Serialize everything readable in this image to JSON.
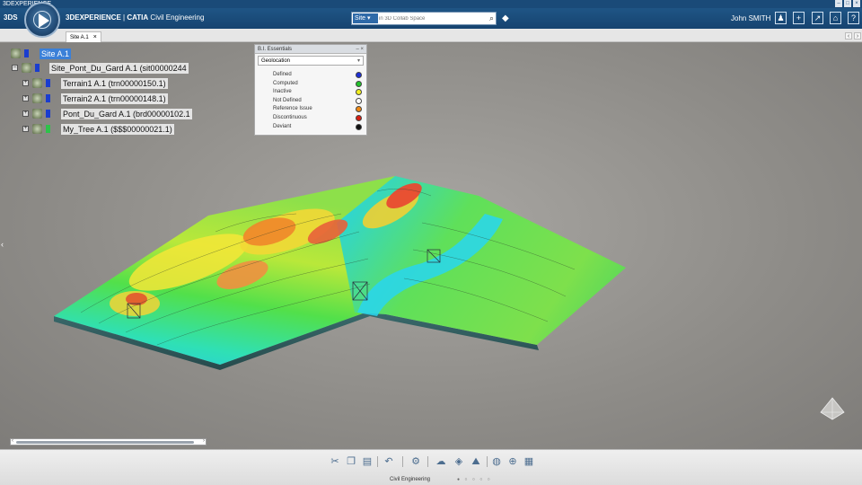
{
  "window": {
    "title": "3DEXPERIENCE",
    "controls": [
      "–",
      "□",
      "×"
    ]
  },
  "topbar": {
    "brand_mark": "3DS",
    "app_brand": "3DEXPERIENCE",
    "app_separator": " | ",
    "app_product": "CATIA",
    "app_role": " Civil Engineering",
    "search_scope": "Site ▾",
    "search_placeholder": "in 3D Collab Space",
    "user": "John SMITH",
    "buttons": [
      "user-icon",
      "plus-icon",
      "share-icon",
      "home-icon",
      "help-icon"
    ]
  },
  "tabs": [
    {
      "label": "Site A.1",
      "close": "×"
    }
  ],
  "tree": {
    "nodes": [
      {
        "label": "Site A.1",
        "flag_color": "#1a3dcf",
        "selected": true,
        "expander": ""
      },
      {
        "label": "Site_Pont_Du_Gard A.1 (sit00000244",
        "flag_color": "#1a3dcf",
        "selected": false,
        "expander": "–"
      },
      {
        "label": "Terrain1 A.1 (trn00000150.1)",
        "flag_color": "#1a3dcf",
        "selected": false,
        "expander": "+"
      },
      {
        "label": "Terrain2 A.1 (trn00000148.1)",
        "flag_color": "#1a3dcf",
        "selected": false,
        "expander": "+"
      },
      {
        "label": "Pont_Du_Gard A.1 (brd00000102.1",
        "flag_color": "#1a3dcf",
        "selected": false,
        "expander": "+"
      },
      {
        "label": "My_Tree A.1 ($$$00000021.1)",
        "flag_color": "#2ec24a",
        "selected": false,
        "expander": "+"
      }
    ]
  },
  "bi_panel": {
    "title": "B.I. Essentials",
    "selected": "Geolocation",
    "legend": [
      {
        "label": "Defined",
        "color": "#1e2fd6"
      },
      {
        "label": "Computed",
        "color": "#22c22a"
      },
      {
        "label": "Inactive",
        "color": "#f2ee1e"
      },
      {
        "label": "Not Defined",
        "color": "#ffffff"
      },
      {
        "label": "Reference Issue",
        "color": "#f08a16"
      },
      {
        "label": "Discontinuous",
        "color": "#d81e12"
      },
      {
        "label": "Deviant",
        "color": "#111111"
      }
    ]
  },
  "viewport": {
    "nav_arrow": "‹"
  },
  "toolbar": {
    "caption": "Civil Engineering",
    "pages": "● ○ ○ ○ ○",
    "tools": [
      "cut-icon",
      "copy-icon",
      "paste-icon",
      "undo-icon",
      "settings-icon",
      "cloud-icon",
      "tag-icon",
      "terrain-icon",
      "sphere-icon",
      "globe-icon",
      "table-icon"
    ]
  }
}
